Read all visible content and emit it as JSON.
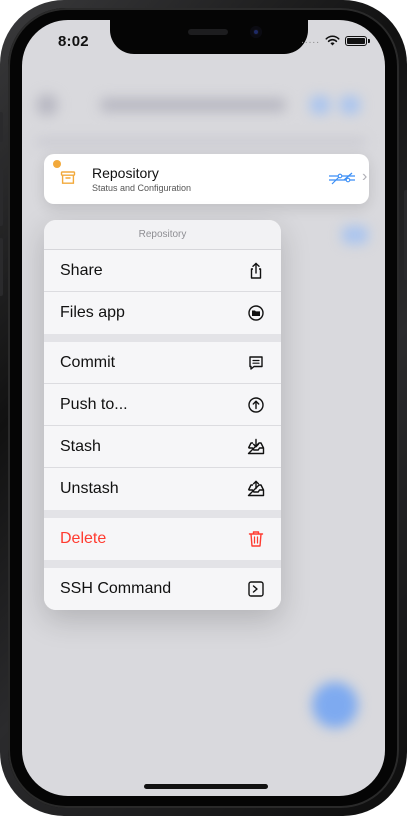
{
  "status": {
    "time": "8:02",
    "dots": "....."
  },
  "repo_card": {
    "title": "Repository",
    "subtitle": "Status and Configuration",
    "chevron": "›"
  },
  "menu": {
    "header": "Repository",
    "items": [
      {
        "label": "Share",
        "icon": "share-icon"
      },
      {
        "label": "Files app",
        "icon": "folder-icon"
      },
      {
        "label": "Commit",
        "icon": "commit-icon"
      },
      {
        "label": "Push to...",
        "icon": "push-icon"
      },
      {
        "label": "Stash",
        "icon": "stash-icon"
      },
      {
        "label": "Unstash",
        "icon": "unstash-icon"
      },
      {
        "label": "Delete",
        "icon": "trash-icon"
      },
      {
        "label": "SSH Command",
        "icon": "terminal-icon"
      }
    ]
  },
  "colors": {
    "accent": "#f2a93b",
    "graph": "#3a8ef6",
    "danger": "#ff3b30"
  }
}
